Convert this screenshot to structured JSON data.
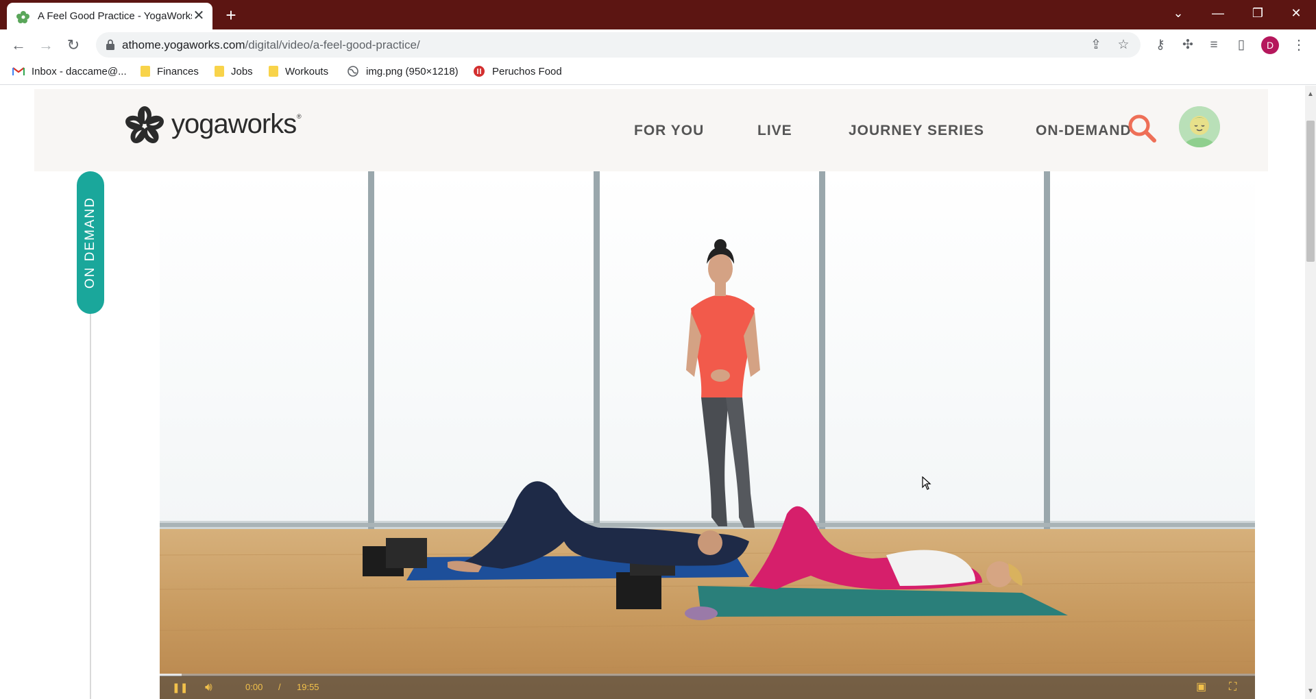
{
  "browser": {
    "tab_title": "A Feel Good Practice - YogaWorks",
    "tab_close": "✕",
    "new_tab": "+",
    "url_host": "athome.yogaworks.com",
    "url_path": "/digital/video/a-feel-good-practice/",
    "profile_initial": "D",
    "window_controls": {
      "tab_search": "⌄",
      "minimize": "—",
      "restore": "❐",
      "close": "✕"
    }
  },
  "bookmarks": [
    {
      "label": "Inbox - daccame@...",
      "icon": "gmail-icon"
    },
    {
      "label": "Finances",
      "icon": "folder-icon"
    },
    {
      "label": "Jobs",
      "icon": "folder-icon"
    },
    {
      "label": "Workouts",
      "icon": "folder-icon"
    },
    {
      "label": "img.png (950×1218)",
      "icon": "globe-icon"
    },
    {
      "label": "Peruchos Food",
      "icon": "food-icon"
    }
  ],
  "site": {
    "logo_text": "yogaworks",
    "logo_mark": "®",
    "nav": [
      "FOR YOU",
      "LIVE",
      "JOURNEY SERIES",
      "ON-DEMAND"
    ],
    "side_label": "ON DEMAND"
  },
  "video": {
    "current_time": "0:00",
    "separator": "/",
    "duration": "19:55",
    "progress_fraction": 0.02,
    "accent_color": "#f2c14b"
  },
  "colors": {
    "titlebar": "#5c1512",
    "teal": "#1aa79b",
    "search": "#ee6f57"
  }
}
